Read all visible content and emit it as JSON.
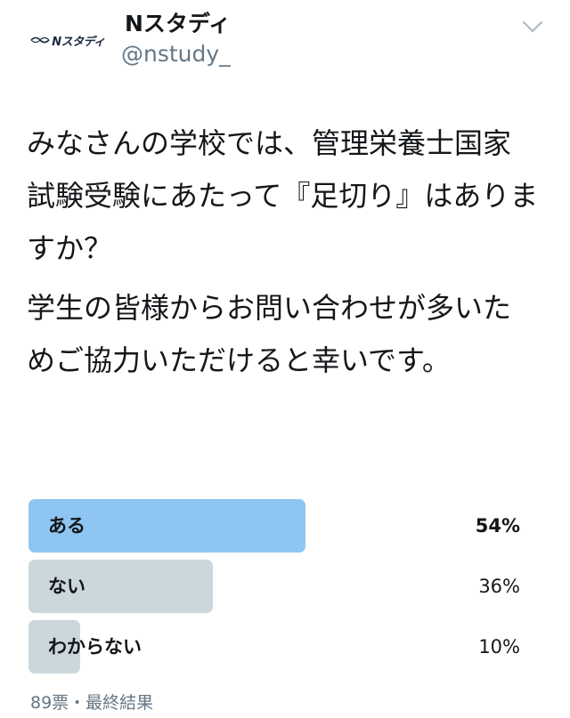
{
  "header": {
    "display_name": "Nスタディ",
    "handle": "@nstudy_",
    "avatar_text": "Nスタディ",
    "avatar_icon": "x-swoosh-icon",
    "menu_icon": "chevron-down-icon"
  },
  "tweet": {
    "paragraph_1": "みなさんの学校では、管理栄養士国家試験受験にあたって『足切り』はありますか？",
    "paragraph_2": "学生の皆様からお問い合わせが多いためご協力いただけると幸いです。"
  },
  "poll": {
    "options": [
      {
        "label": "ある",
        "percent_text": "54%",
        "percent": 54,
        "winner": true,
        "color": "#8ec5f2"
      },
      {
        "label": "ない",
        "percent_text": "36%",
        "percent": 36,
        "winner": false,
        "color": "#ccd6dd"
      },
      {
        "label": "わからない",
        "percent_text": "10%",
        "percent": 10,
        "winner": false,
        "color": "#ccd6dd"
      }
    ],
    "footer": "89票・最終結果"
  }
}
